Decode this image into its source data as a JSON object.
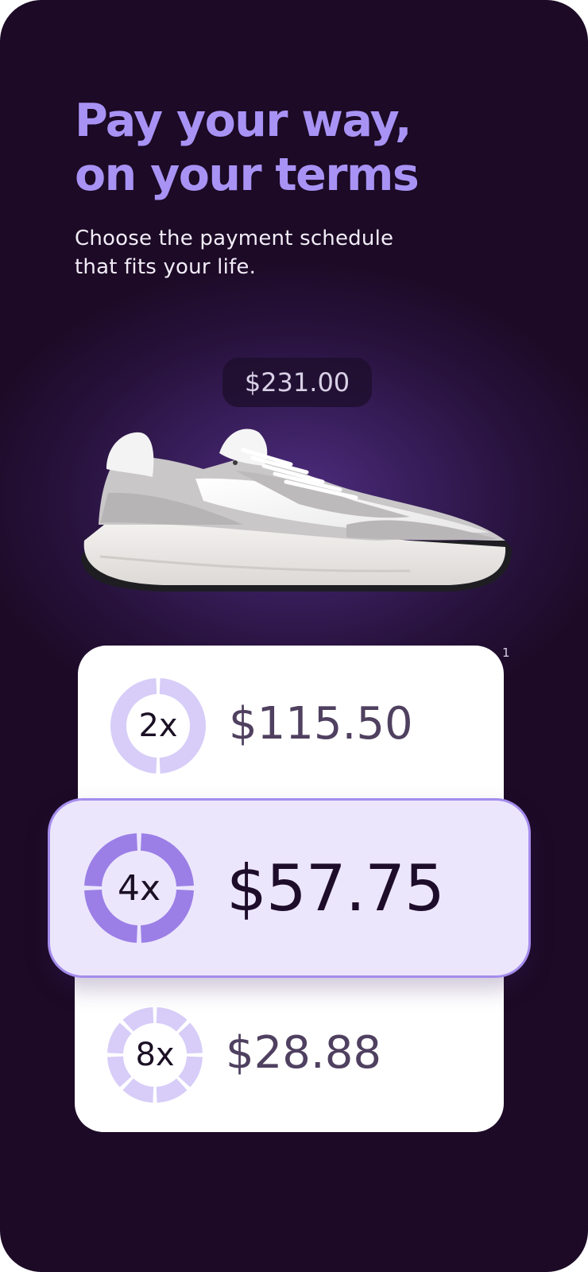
{
  "headline": {
    "line1": "Pay your way,",
    "line2": "on your terms"
  },
  "subheadline": {
    "line1": "Choose the payment schedule",
    "line2": "that fits your life."
  },
  "product": {
    "price": "$231.00",
    "image_icon": "sneaker-image"
  },
  "footnote_marker": "1",
  "plans": [
    {
      "installments": "2x",
      "amount": "$115.50",
      "selected": false,
      "segments": 2
    },
    {
      "installments": "4x",
      "amount": "$57.75",
      "selected": true,
      "segments": 4
    },
    {
      "installments": "8x",
      "amount": "$28.88",
      "selected": false,
      "segments": 8
    }
  ],
  "colors": {
    "background": "#1c0a26",
    "accent": "#a893f5",
    "selected_card": "#ece6fd",
    "selected_border": "#a48cec",
    "ring_light": "#d7cdf8",
    "ring_dark": "#9b7fe6"
  }
}
